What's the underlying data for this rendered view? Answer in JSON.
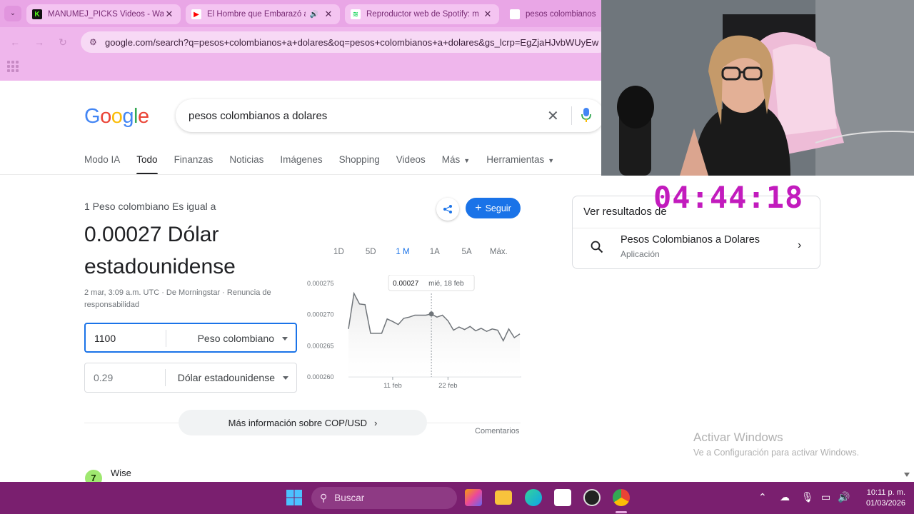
{
  "browser": {
    "tabs": [
      {
        "title": "MANUMEJ_PICKS Videos - Wat",
        "favicon": "K",
        "favicon_color": "#53fc18",
        "speaker": false
      },
      {
        "title": "El Hombre que Embarazó a",
        "favicon": "▶",
        "favicon_color": "#ff0000",
        "speaker": true
      },
      {
        "title": "Reproductor web de Spotify: m",
        "favicon": "≋",
        "favicon_color": "#1ed760",
        "speaker": false
      },
      {
        "title": "pesos colombianos a",
        "favicon": "G",
        "favicon_color": "#ffffff",
        "speaker": false
      }
    ],
    "close_glyph": "✕",
    "url": "google.com/search?q=pesos+colombianos+a+dolares&oq=pesos+colombianos+a+dolares&gs_lcrp=EgZjaHJvbWUyEw"
  },
  "google": {
    "logo_letters": [
      {
        "ch": "G",
        "color": "#4285f4"
      },
      {
        "ch": "o",
        "color": "#ea4335"
      },
      {
        "ch": "o",
        "color": "#fbbc05"
      },
      {
        "ch": "g",
        "color": "#4285f4"
      },
      {
        "ch": "l",
        "color": "#34a853"
      },
      {
        "ch": "e",
        "color": "#ea4335"
      }
    ],
    "query": "pesos colombianos a dolares",
    "nav_tabs": [
      {
        "label": "Modo IA",
        "selected": false,
        "caret": false
      },
      {
        "label": "Todo",
        "selected": true,
        "caret": false
      },
      {
        "label": "Finanzas",
        "selected": false,
        "caret": false
      },
      {
        "label": "Noticias",
        "selected": false,
        "caret": false
      },
      {
        "label": "Imágenes",
        "selected": false,
        "caret": false
      },
      {
        "label": "Shopping",
        "selected": false,
        "caret": false
      },
      {
        "label": "Videos",
        "selected": false,
        "caret": false
      },
      {
        "label": "Más",
        "selected": false,
        "caret": true
      },
      {
        "label": "Herramientas",
        "selected": false,
        "caret": true
      }
    ]
  },
  "converter": {
    "equals_label": "1 Peso colombiano Es igual a",
    "result_line1": "0.00027 Dólar",
    "result_line2": "estadounidense",
    "meta_line1": "2 mar, 3:09 a.m. UTC · De Morningstar · Renuncia de",
    "meta_line2": "responsabilidad",
    "follow_label": "Seguir",
    "from_amount": "1100",
    "from_unit": "Peso colombiano",
    "to_amount": "0.29",
    "to_unit": "Dólar estadounidense",
    "periods": [
      {
        "label": "1D",
        "selected": false
      },
      {
        "label": "5D",
        "selected": false
      },
      {
        "label": "1 M",
        "selected": true
      },
      {
        "label": "1A",
        "selected": false
      },
      {
        "label": "5A",
        "selected": false
      },
      {
        "label": "Máx.",
        "selected": false
      }
    ],
    "more_info_label": "Más información sobre COP/USD",
    "comments_label": "Comentarios",
    "wise_label": "Wise"
  },
  "chart_data": {
    "type": "line",
    "ylim": [
      0.00026,
      0.000275
    ],
    "y_ticks": [
      "0.000275",
      "0.000270",
      "0.000265",
      "0.000260"
    ],
    "x_tick_labels": [
      {
        "label": "11 feb",
        "at_index": 8
      },
      {
        "label": "22 feb",
        "at_index": 18
      }
    ],
    "values": [
      0.0002677,
      0.0002734,
      0.0002717,
      0.0002716,
      0.000267,
      0.000267,
      0.000267,
      0.0002693,
      0.0002689,
      0.0002684,
      0.0002694,
      0.0002696,
      0.0002699,
      0.0002699,
      0.0002699,
      0.0002701,
      0.0002696,
      0.0002699,
      0.000269,
      0.0002675,
      0.000268,
      0.0002676,
      0.0002681,
      0.0002674,
      0.0002678,
      0.0002673,
      0.0002677,
      0.0002675,
      0.0002658,
      0.0002677,
      0.0002663,
      0.0002669
    ],
    "tooltip_index": 15,
    "tooltip_value": "0.00027",
    "tooltip_date": "mié, 18 feb",
    "line_color": "#70757a",
    "fill_color": "#e8e8e8"
  },
  "side_card": {
    "heading": "Ver resultados de",
    "title": "Pesos Colombianos a Dolares",
    "subtitle": "Aplicación"
  },
  "watermark": {
    "line1": "Activar Windows",
    "line2": "Ve a Configuración para activar Windows."
  },
  "overlay": {
    "timer": "04:44:18"
  },
  "taskbar": {
    "search_label": "Buscar",
    "time": "10:11 p. m.",
    "date": "01/03/2026"
  }
}
